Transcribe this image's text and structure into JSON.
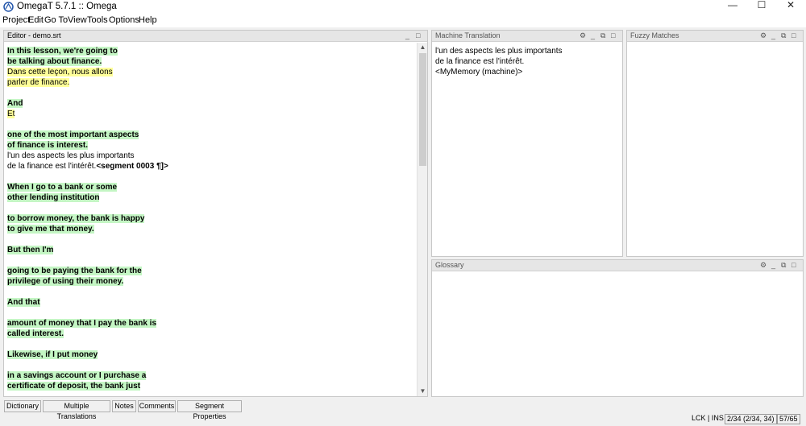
{
  "window": {
    "title": "OmegaT 5.7.1 :: Omega",
    "min_label": "—",
    "max_label": "☐",
    "close_label": "✕"
  },
  "menu": [
    "Project",
    "Edit",
    "Go To",
    "View",
    "Tools",
    "Options",
    "Help"
  ],
  "editor": {
    "title": "Editor - demo.srt",
    "segments": [
      {
        "source": [
          "In this lesson, we're going to",
          "be talking about finance."
        ],
        "target": [
          "Dans cette leçon, nous allons",
          "parler de finance."
        ]
      },
      {
        "source": [
          "And"
        ],
        "target": [
          "Et"
        ]
      },
      {
        "source": [
          "one of the most important aspects",
          "of finance is interest."
        ],
        "target": [
          "l'un des aspects les plus importants",
          "de la finance est l'intérêt."
        ],
        "marker": "<segment 0003 ¶]>"
      },
      {
        "source": [
          "When I go to a bank or some",
          "other lending institution"
        ]
      },
      {
        "source": [
          "to borrow money, the bank is happy",
          "to give me that money."
        ]
      },
      {
        "source": [
          "But then I'm"
        ]
      },
      {
        "source": [
          "going to be paying the bank for the",
          "privilege of using their money."
        ]
      },
      {
        "source": [
          "And that"
        ]
      },
      {
        "source": [
          "amount of money that I pay the bank is",
          "called interest."
        ]
      },
      {
        "source": [
          "Likewise, if I put money"
        ]
      },
      {
        "source": [
          "in a savings account or I purchase a",
          "certificate of deposit, the bank just"
        ]
      }
    ]
  },
  "machine_translation": {
    "title": "Machine Translation",
    "lines": [
      "l'un des aspects les plus importants",
      "de la finance est l'intérêt.",
      "<MyMemory (machine)>"
    ]
  },
  "fuzzy_matches": {
    "title": "Fuzzy Matches"
  },
  "glossary": {
    "title": "Glossary"
  },
  "bottom_tabs": [
    "Dictionary",
    "Multiple Translations",
    "Notes",
    "Comments",
    "Segment Properties"
  ],
  "status": {
    "lock": "LCK | INS",
    "progress": "2/34 (2/34, 34)",
    "count": "57/65"
  },
  "icons": {
    "gear": "⚙",
    "minimize": "_",
    "undock": "⧉",
    "maximize": "□"
  }
}
